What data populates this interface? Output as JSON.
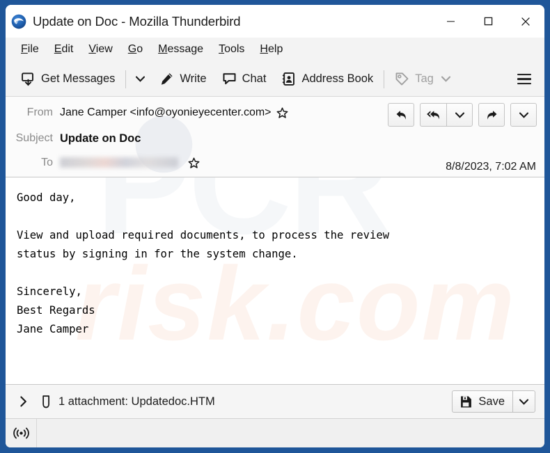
{
  "window": {
    "title": "Update on Doc - Mozilla Thunderbird",
    "app_icon": "thunderbird-icon",
    "frame_color": "#1f5699",
    "controls": {
      "minimize": "minimize-icon",
      "maximize": "maximize-icon",
      "close": "close-icon"
    }
  },
  "menubar": {
    "items": [
      {
        "label": "File",
        "accel": "F"
      },
      {
        "label": "Edit",
        "accel": "E"
      },
      {
        "label": "View",
        "accel": "V"
      },
      {
        "label": "Go",
        "accel": "G"
      },
      {
        "label": "Message",
        "accel": "M"
      },
      {
        "label": "Tools",
        "accel": "T"
      },
      {
        "label": "Help",
        "accel": "H"
      }
    ]
  },
  "toolbar": {
    "get_messages_label": "Get Messages",
    "get_messages_icon": "get-messages-icon",
    "get_messages_caret": "chevron-down-icon",
    "write_label": "Write",
    "write_icon": "pencil-icon",
    "chat_label": "Chat",
    "chat_icon": "chat-bubble-icon",
    "address_book_label": "Address Book",
    "address_book_icon": "address-book-icon",
    "tag_label": "Tag",
    "tag_icon": "tag-icon",
    "tag_caret": "chevron-down-icon",
    "tag_disabled": true,
    "app_menu_icon": "hamburger-menu-icon"
  },
  "message_header": {
    "from_label": "From",
    "from_value": "Jane Camper <info@oyonieyecenter.com>",
    "from_star_icon": "star-icon",
    "subject_label": "Subject",
    "subject_value": "Update on Doc",
    "date": "8/8/2023, 7:02 AM",
    "to_label": "To",
    "to_value": "",
    "to_redacted": true,
    "to_star_icon": "star-icon",
    "actions": {
      "reply_icon": "reply-icon",
      "reply_all_icon": "reply-all-icon",
      "reply_all_caret": "chevron-down-icon",
      "forward_icon": "forward-icon",
      "more_caret": "chevron-down-icon"
    }
  },
  "message_body": {
    "text": "Good day,\n\nView and upload required documents, to process the review\nstatus by signing in for the system change.\n\nSincerely,\nBest Regards\nJane Camper",
    "watermark_top": "PCR",
    "watermark_bottom": "risk.com"
  },
  "attachment_bar": {
    "expander_icon": "chevron-right-icon",
    "paperclip_icon": "paperclip-icon",
    "summary": "1 attachment: Updatedoc.HTM",
    "save_label": "Save",
    "save_icon": "save-file-icon",
    "save_caret": "chevron-down-icon"
  },
  "statusbar": {
    "connection_icon": "broadcast-icon",
    "text": ""
  }
}
